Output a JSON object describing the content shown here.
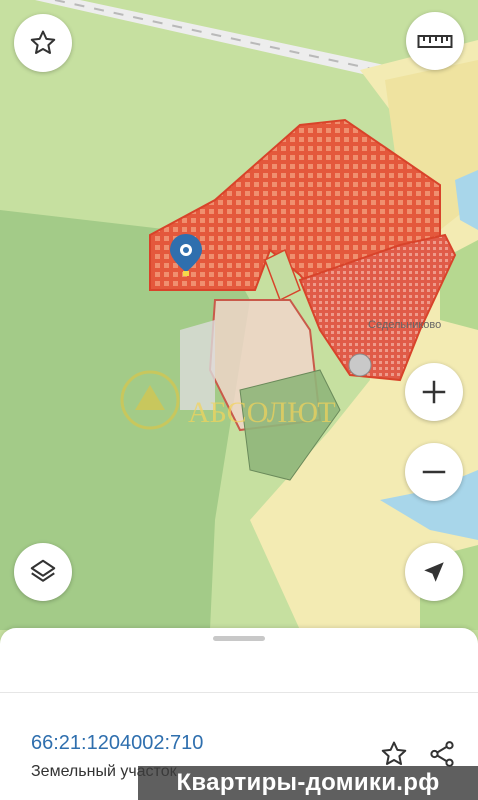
{
  "map": {
    "place_label": "Седельниково",
    "logo_text": "АБСОЛЮТ",
    "pin_color": "#2f6fae",
    "parcel_color": "#e0533a"
  },
  "controls": {
    "favorite_icon": "star-icon",
    "ruler_icon": "ruler-icon",
    "layers_icon": "layers-icon",
    "zoom_in_icon": "plus-icon",
    "zoom_out_icon": "minus-icon",
    "locate_icon": "navigation-arrow-icon"
  },
  "parcel": {
    "cadastral_number": "66:21:1204002:710",
    "type": "Земельный участок"
  },
  "watermark": {
    "text": "Квартиры-домики.рф"
  }
}
